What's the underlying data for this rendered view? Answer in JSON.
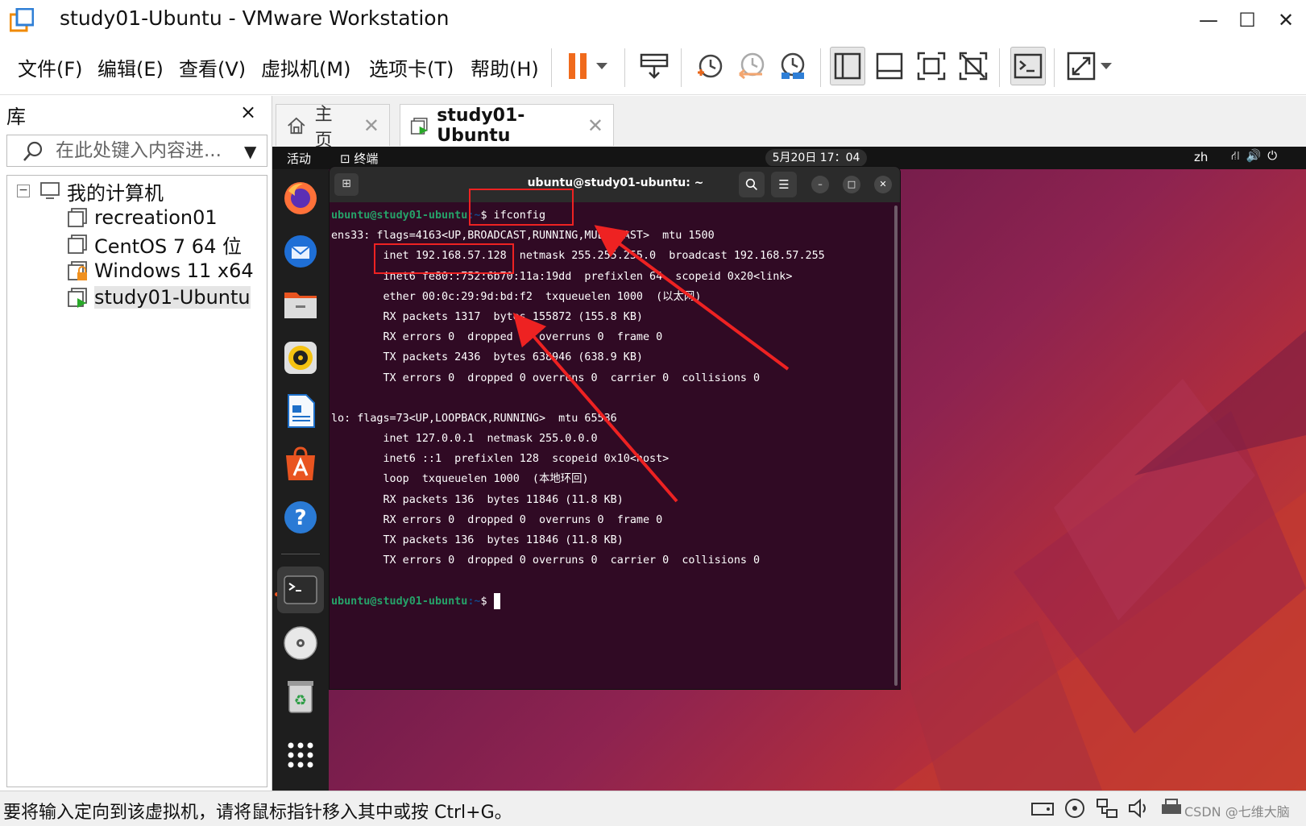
{
  "window": {
    "title": "study01-Ubuntu - VMware Workstation",
    "controls": [
      "—",
      "☐",
      "✕"
    ]
  },
  "menu": [
    "文件(F)",
    "编辑(E)",
    "查看(V)",
    "虚拟机(M)",
    "选项卡(T)",
    "帮助(H)"
  ],
  "toolbar": {
    "icons": [
      "pause-icon",
      "send-ctrl-alt-del-icon",
      "snapshot-take-icon",
      "snapshot-revert-icon",
      "snapshot-manager-icon",
      "library-view-icon",
      "thumbnail-bar-icon",
      "full-screen-icon",
      "unity-icon",
      "console-view-icon",
      "stretch-guest-icon"
    ]
  },
  "library": {
    "title": "库",
    "close": "×",
    "search_placeholder": "在此处键入内容进...",
    "root": "我的计算机",
    "items": [
      {
        "label": "recreation01",
        "icon": "vm-icon"
      },
      {
        "label": "CentOS 7 64 位",
        "icon": "vm-icon"
      },
      {
        "label": "Windows 11 x64",
        "icon": "vm-locked-icon"
      },
      {
        "label": "study01-Ubuntu",
        "icon": "vm-running-icon",
        "selected": true
      }
    ]
  },
  "tabs": [
    {
      "label": "主页",
      "close": "✕"
    },
    {
      "label": "study01-Ubuntu",
      "close": "✕",
      "active": true
    }
  ],
  "guest": {
    "activities": "活动",
    "app_name": "终端",
    "clock": "5月20日  17：04",
    "lang": "zh",
    "terminal": {
      "title": "ubuntu@study01-ubuntu: ~",
      "prompt_user": "ubuntu@study01-ubuntu",
      "prompt_path": ":~",
      "command": "$ ifconfig",
      "lines": [
        "ens33: flags=4163<UP,BROADCAST,RUNNING,MULTICAST>  mtu 1500",
        "        inet 192.168.57.128  netmask 255.255.255.0  broadcast 192.168.57.255",
        "        inet6 fe80::752:6b70:11a:19dd  prefixlen 64  scopeid 0x20<link>",
        "        ether 00:0c:29:9d:bd:f2  txqueuelen 1000  (以太网)",
        "        RX packets 1317  bytes 155872 (155.8 KB)",
        "        RX errors 0  dropped 0  overruns 0  frame 0",
        "        TX packets 2436  bytes 638946 (638.9 KB)",
        "        TX errors 0  dropped 0 overruns 0  carrier 0  collisions 0",
        "",
        "lo: flags=73<UP,LOOPBACK,RUNNING>  mtu 65536",
        "        inet 127.0.0.1  netmask 255.0.0.0",
        "        inet6 ::1  prefixlen 128  scopeid 0x10<host>",
        "        loop  txqueuelen 1000  (本地环回)",
        "        RX packets 136  bytes 11846 (11.8 KB)",
        "        RX errors 0  dropped 0  overruns 0  frame 0",
        "        TX packets 136  bytes 11846 (11.8 KB)",
        "        TX errors 0  dropped 0 overruns 0  carrier 0  collisions 0",
        ""
      ],
      "final_prompt": "$"
    }
  },
  "status": {
    "text": "要将输入定向到该虚拟机，请将鼠标指针移入其中或按 Ctrl+G。",
    "watermark": "CSDN @七维大脑"
  },
  "colors": {
    "terminal_bg": "#300a24",
    "prompt_green": "#26a269",
    "annotation_red": "#e22222",
    "ubuntu_orange": "#e95420"
  }
}
